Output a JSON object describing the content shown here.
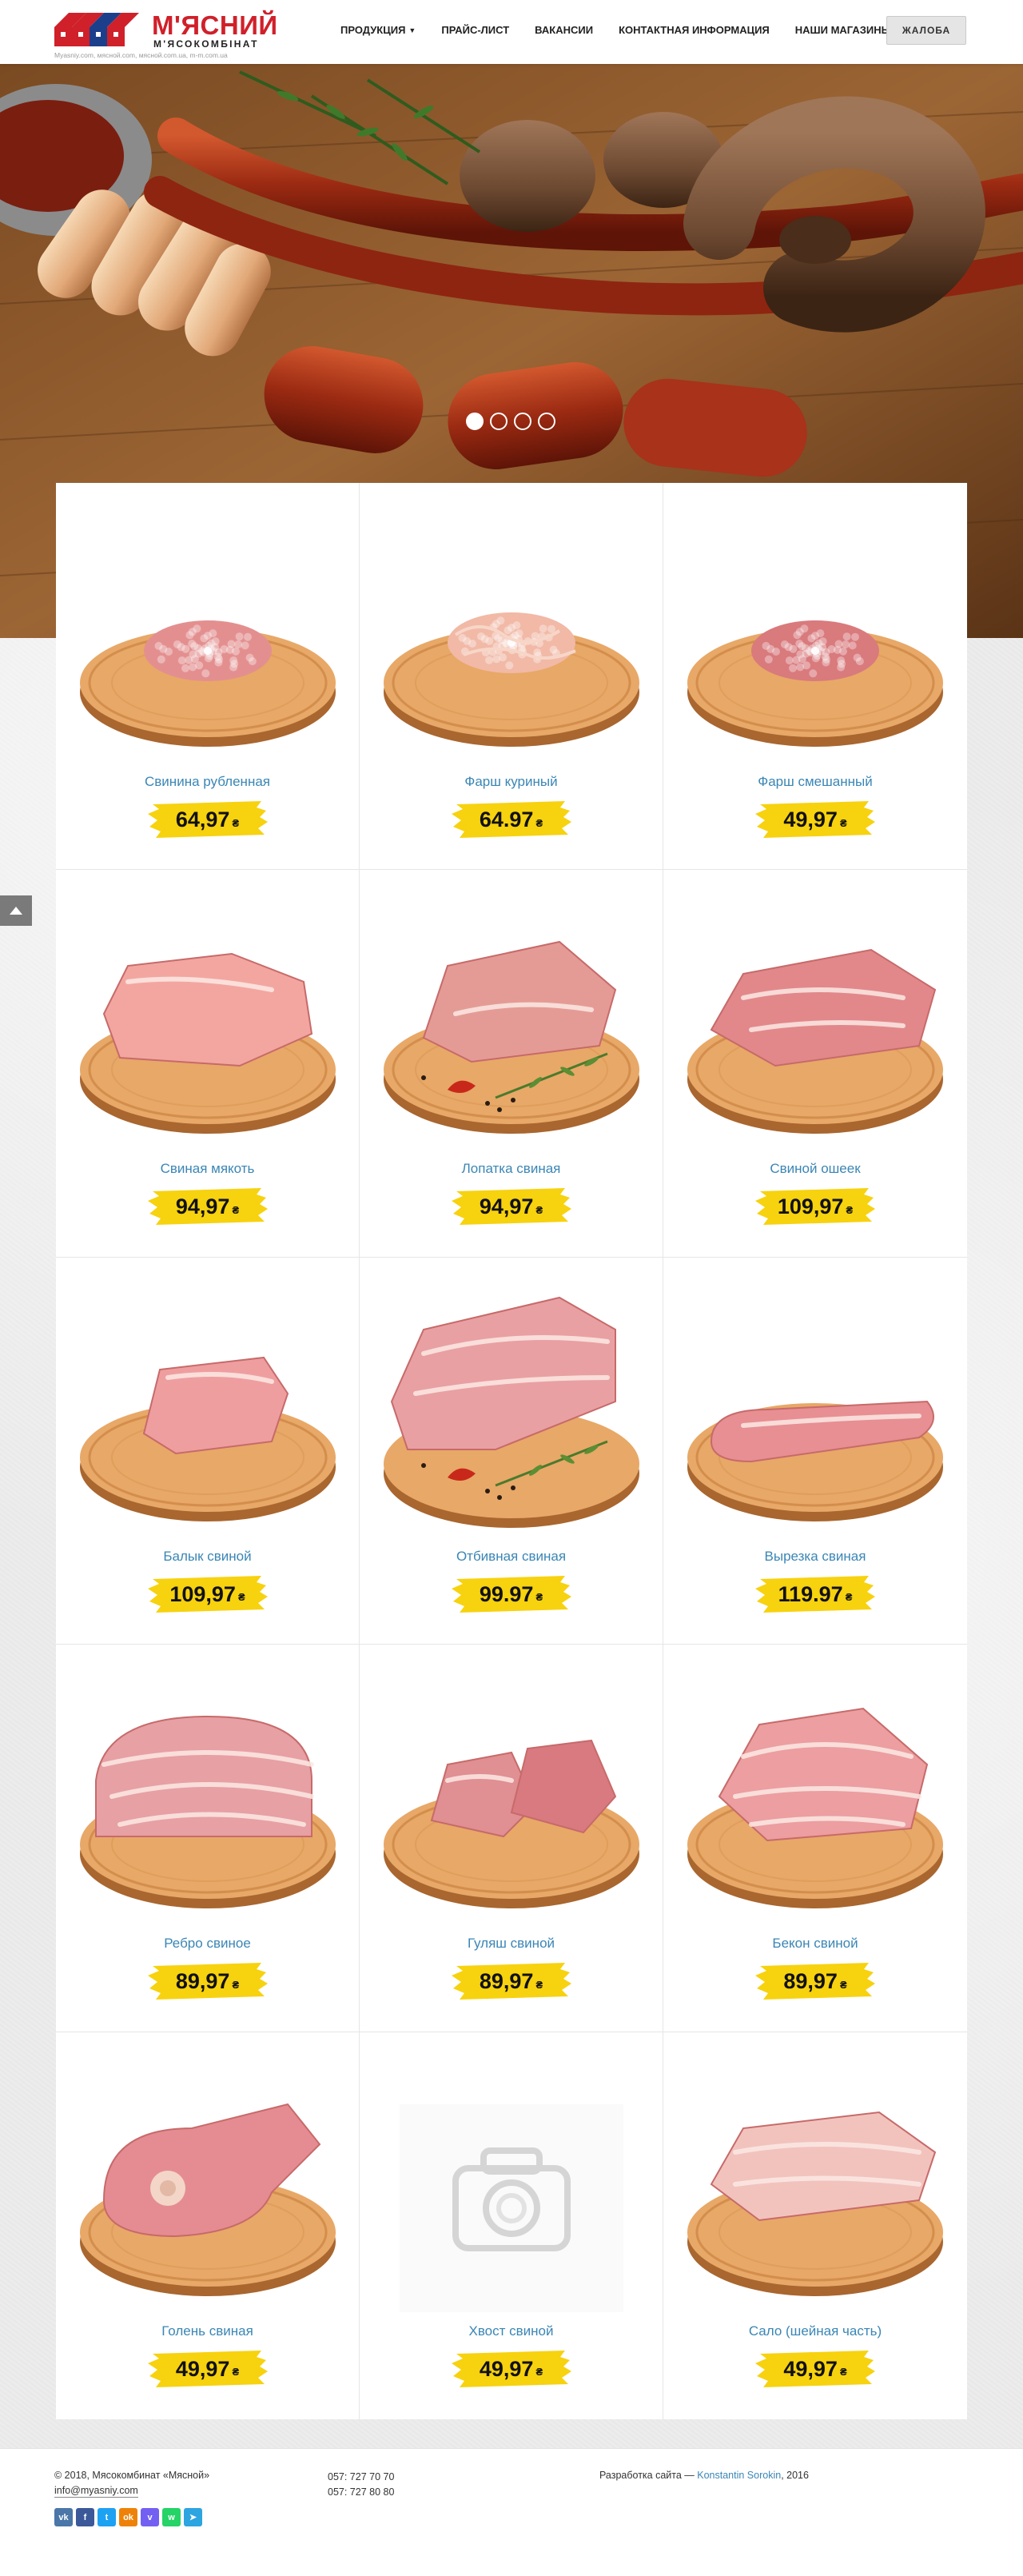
{
  "header": {
    "logo_title": "М'ЯСНИЙ",
    "logo_subtitle": "М'ЯСОКОМБІНАТ",
    "logo_domains": "Myasniy.com, мясной.com, мясной.com.ua, m-m.com.ua",
    "nav": [
      {
        "label": "Продукция",
        "has_dropdown": true
      },
      {
        "label": "Прайс-лист",
        "has_dropdown": false
      },
      {
        "label": "Вакансии",
        "has_dropdown": false
      },
      {
        "label": "Контактная информация",
        "has_dropdown": false
      },
      {
        "label": "Наши магазины",
        "has_dropdown": false
      }
    ],
    "complaint_label": "Жалоба"
  },
  "slider": {
    "slide_count": 4,
    "active_slide": 1
  },
  "currency_symbol": "₴",
  "products": [
    {
      "name": "Свинина рубленная",
      "price": "64,97",
      "image": "minced-pork"
    },
    {
      "name": "Фарш куриный",
      "price": "64.97",
      "image": "minced-chicken"
    },
    {
      "name": "Фарш смешанный",
      "price": "49,97",
      "image": "minced-mixed"
    },
    {
      "name": "Свиная мякоть",
      "price": "94,97",
      "image": "pork-flesh"
    },
    {
      "name": "Лопатка свиная",
      "price": "94,97",
      "image": "pork-shoulder"
    },
    {
      "name": "Свиной ошеек",
      "price": "109,97",
      "image": "pork-neck"
    },
    {
      "name": "Балык свиной",
      "price": "109,97",
      "image": "pork-balyk"
    },
    {
      "name": "Отбивная свиная",
      "price": "99.97",
      "image": "pork-chop"
    },
    {
      "name": "Вырезка свиная",
      "price": "119.97",
      "image": "pork-tenderloin"
    },
    {
      "name": "Ребро свиное",
      "price": "89,97",
      "image": "pork-ribs"
    },
    {
      "name": "Гуляш свиной",
      "price": "89,97",
      "image": "pork-goulash"
    },
    {
      "name": "Бекон свиной",
      "price": "89,97",
      "image": "pork-bacon"
    },
    {
      "name": "Голень свиная",
      "price": "49,97",
      "image": "pork-shank"
    },
    {
      "name": "Хвост свиной",
      "price": "49,97",
      "image": "placeholder-camera"
    },
    {
      "name": "Сало (шейная часть)",
      "price": "49,97",
      "image": "pork-lard"
    }
  ],
  "colors": {
    "brand_red": "#d0202a",
    "price_yellow": "#f7d20e",
    "link_blue": "#3a86b5"
  },
  "footer": {
    "copyright": "© 2018, Мясокомбинат «Мясной»",
    "email": "info@myasniy.com",
    "phones": [
      "057: 727 70 70",
      "057: 727 80 80"
    ],
    "dev_text": "Разработка сайта — ",
    "dev_name": "Konstantin Sorokin",
    "dev_year": ", 2016",
    "socials": [
      {
        "name": "vk",
        "glyph": "vk",
        "color": "#4a76a8"
      },
      {
        "name": "facebook",
        "glyph": "f",
        "color": "#3b5998"
      },
      {
        "name": "twitter",
        "glyph": "t",
        "color": "#1da1f2"
      },
      {
        "name": "odnoklassniki",
        "glyph": "ok",
        "color": "#ee8208"
      },
      {
        "name": "viber",
        "glyph": "v",
        "color": "#7360f2"
      },
      {
        "name": "whatsapp",
        "glyph": "w",
        "color": "#25d366"
      },
      {
        "name": "telegram",
        "glyph": "➤",
        "color": "#2ca5e0"
      }
    ]
  }
}
